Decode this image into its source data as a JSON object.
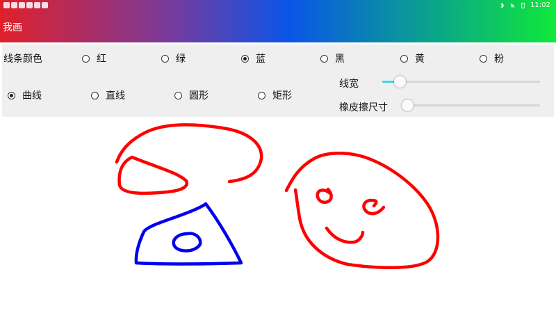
{
  "status": {
    "time": "11:02"
  },
  "app": {
    "title": "我画"
  },
  "controls": {
    "color_label": "线条颜色",
    "colors": [
      {
        "label": "红",
        "checked": false
      },
      {
        "label": "绿",
        "checked": false
      },
      {
        "label": "蓝",
        "checked": true
      },
      {
        "label": "黑",
        "checked": false
      },
      {
        "label": "黄",
        "checked": false
      },
      {
        "label": "粉",
        "checked": false
      }
    ],
    "shapes": [
      {
        "label": "曲线",
        "checked": true
      },
      {
        "label": "直线",
        "checked": false
      },
      {
        "label": "圆形",
        "checked": false
      },
      {
        "label": "矩形",
        "checked": false
      }
    ],
    "line_width_label": "线宽",
    "line_width_level": 0.1,
    "eraser_label": "橡皮擦尺寸",
    "eraser_level": 0.0
  },
  "drawing": {
    "colors": {
      "red": "#ff0000",
      "blue": "#0000ee"
    }
  },
  "theme": {
    "accent": "#39d6f0"
  }
}
